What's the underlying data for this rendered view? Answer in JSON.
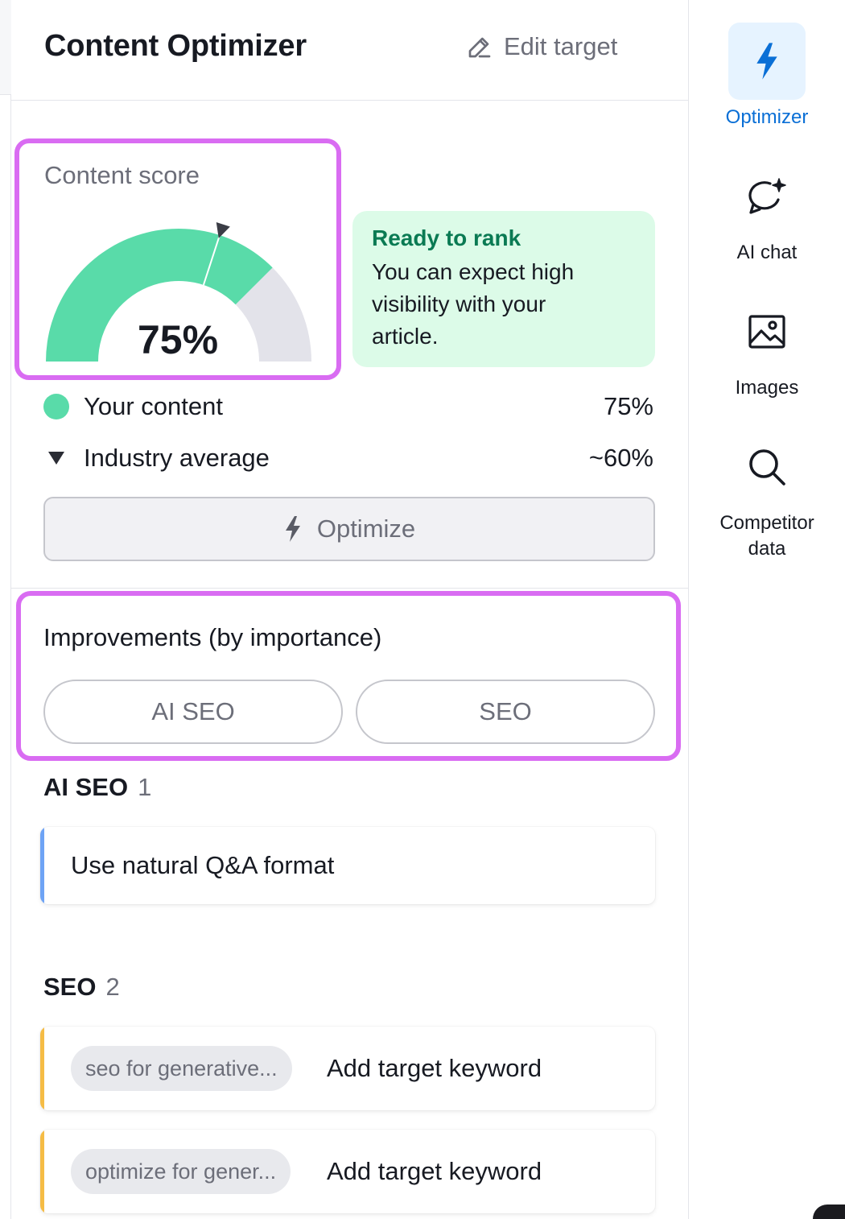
{
  "header": {
    "title": "Content Optimizer",
    "edit_target_label": "Edit target",
    "edit_icon": "pencil-icon"
  },
  "content_score": {
    "label": "Content score",
    "value_text": "75%",
    "score_fraction": 0.75,
    "industry_marker_fraction": 0.6,
    "colors": {
      "filled": "#59dba9",
      "remaining": "#e3e3ea",
      "marker": "#3b3d46"
    }
  },
  "rank_card": {
    "title": "Ready to rank",
    "text_lines": [
      "You can expect high",
      "visibility with your",
      "article."
    ]
  },
  "legend": {
    "your_content": {
      "label": "Your content",
      "value": "75%"
    },
    "industry_average": {
      "label": "Industry average",
      "value": "~60%"
    }
  },
  "optimize_button": {
    "label": "Optimize",
    "icon": "lightning-icon"
  },
  "improvements": {
    "title": "Improvements (by importance)",
    "tabs": [
      {
        "label": "AI SEO"
      },
      {
        "label": "SEO"
      }
    ]
  },
  "sections": {
    "ai_seo": {
      "title": "AI SEO",
      "count": "1",
      "items": [
        {
          "text": "Use natural Q&A format"
        }
      ]
    },
    "seo": {
      "title": "SEO",
      "count": "2",
      "items": [
        {
          "chip": "seo for generative...",
          "text": "Add target keyword"
        },
        {
          "chip": "optimize for gener...",
          "text": "Add target keyword"
        }
      ]
    }
  },
  "sidebar": {
    "items": [
      {
        "label": "Optimizer",
        "icon": "lightning-icon",
        "active": true
      },
      {
        "label": "AI chat",
        "icon": "chat-sparkle-icon",
        "active": false
      },
      {
        "label": "Images",
        "icon": "image-icon",
        "active": false
      },
      {
        "label": "Competitor data",
        "label_lines": [
          "Competitor",
          "data"
        ],
        "icon": "search-icon",
        "active": false
      }
    ]
  },
  "colors": {
    "accent_purple_outline": "#d96cf2",
    "active_blue": "#0a6fd6",
    "ready_green_bg": "#dcfbe8",
    "ready_green_text": "#0a7a53",
    "ai_seo_bar": "#6ea3f5",
    "seo_bar": "#f5bc45"
  }
}
